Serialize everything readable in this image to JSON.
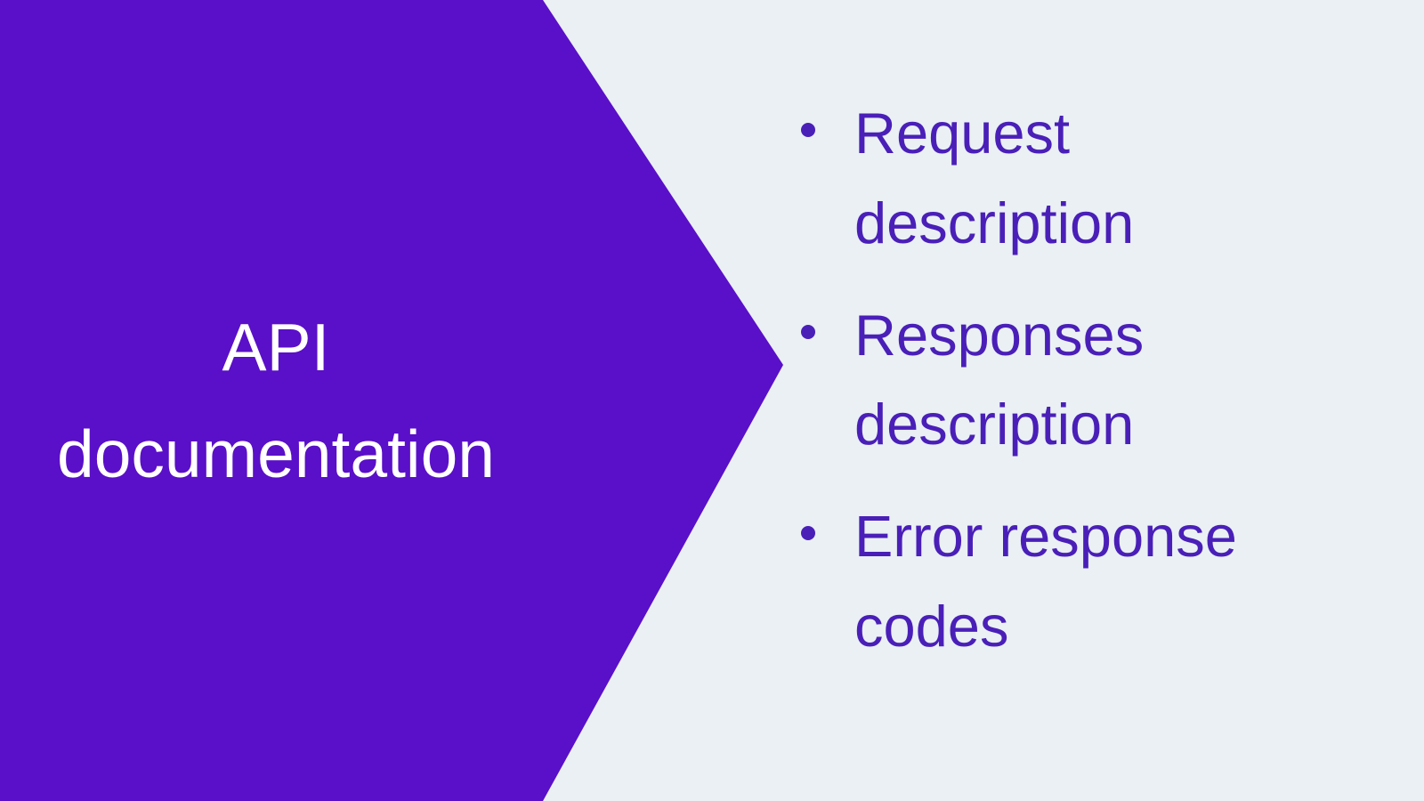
{
  "left": {
    "line1": "API",
    "line2": "documentation"
  },
  "bullets": {
    "item1": "Request description",
    "item2": "Responses description",
    "item3": "Error response codes"
  },
  "colors": {
    "purple": "#5a0fc8",
    "lightBg": "#eaf0f4",
    "bulletText": "#4a1fb8"
  }
}
